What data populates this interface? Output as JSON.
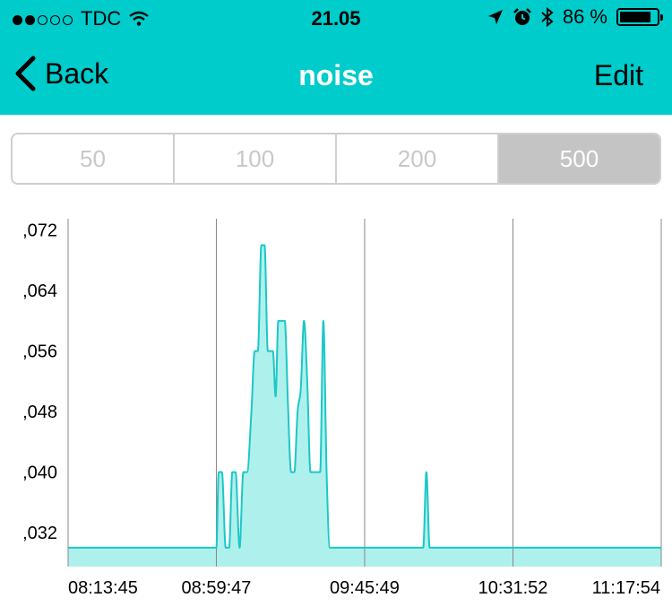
{
  "status_bar": {
    "carrier": "TDC",
    "signal_filled": 2,
    "signal_total": 5,
    "time": "21.05",
    "battery_percent": "86 %",
    "battery_level": 0.86
  },
  "nav": {
    "back_label": "Back",
    "title": "noise",
    "edit_label": "Edit"
  },
  "segments": {
    "options": [
      "50",
      "100",
      "200",
      "500"
    ],
    "selected_index": 3
  },
  "colors": {
    "header": "#00cccc",
    "line": "#1cc7c7",
    "fill": "#aef0ec",
    "grid": "#888888"
  },
  "chart_data": {
    "type": "area",
    "title": "",
    "xlabel": "",
    "ylabel": "",
    "x_ticks": [
      "08:13:45",
      "08:59:47",
      "09:45:49",
      "10:31:52",
      "11:17:54"
    ],
    "y_ticks": [
      ",032",
      ",040",
      ",048",
      ",056",
      ",064",
      ",072"
    ],
    "y_tick_values": [
      0.032,
      0.04,
      0.048,
      0.056,
      0.064,
      0.072
    ],
    "ylim": [
      0.0275,
      0.0735
    ],
    "grid": "vertical",
    "series": [
      {
        "x": [
          "08:13:45",
          "08:59:47",
          "09:00:30",
          "09:01:30",
          "09:02:40",
          "09:03:45",
          "09:04:45",
          "09:05:45",
          "09:07:00",
          "09:08:10",
          "09:09:20",
          "09:10:40",
          "09:11:40",
          "09:12:40",
          "09:13:45",
          "09:14:45",
          "09:15:45",
          "09:16:30",
          "09:17:20",
          "09:18:10",
          "09:19:00",
          "09:20:00",
          "09:21:00",
          "09:22:00",
          "09:23:00",
          "09:24:00",
          "09:25:00",
          "09:26:00",
          "09:27:00",
          "09:28:00",
          "09:29:00",
          "09:30:00",
          "09:31:00",
          "09:32:00",
          "09:33:00",
          "09:34:00",
          "09:35:00",
          "09:36:00",
          "09:37:00",
          "09:38:00",
          "09:39:00",
          "09:40:00",
          "09:41:00",
          "09:42:00",
          "09:43:00",
          "09:44:00",
          "09:45:00",
          "09:45:49",
          "10:04:00",
          "10:05:00",
          "10:06:00",
          "10:07:00",
          "10:08:00",
          "11:17:54"
        ],
        "y": [
          0.03,
          0.03,
          0.04,
          0.04,
          0.03,
          0.03,
          0.04,
          0.04,
          0.03,
          0.04,
          0.04,
          0.048,
          0.056,
          0.056,
          0.07,
          0.07,
          0.056,
          0.056,
          0.056,
          0.05,
          0.06,
          0.06,
          0.06,
          0.049,
          0.04,
          0.04,
          0.048,
          0.051,
          0.06,
          0.052,
          0.04,
          0.04,
          0.04,
          0.04,
          0.06,
          0.04,
          0.03,
          0.03,
          0.03,
          0.03,
          0.03,
          0.03,
          0.03,
          0.03,
          0.03,
          0.03,
          0.03,
          0.03,
          0.03,
          0.04,
          0.03,
          0.03,
          0.03,
          0.03
        ]
      }
    ]
  }
}
